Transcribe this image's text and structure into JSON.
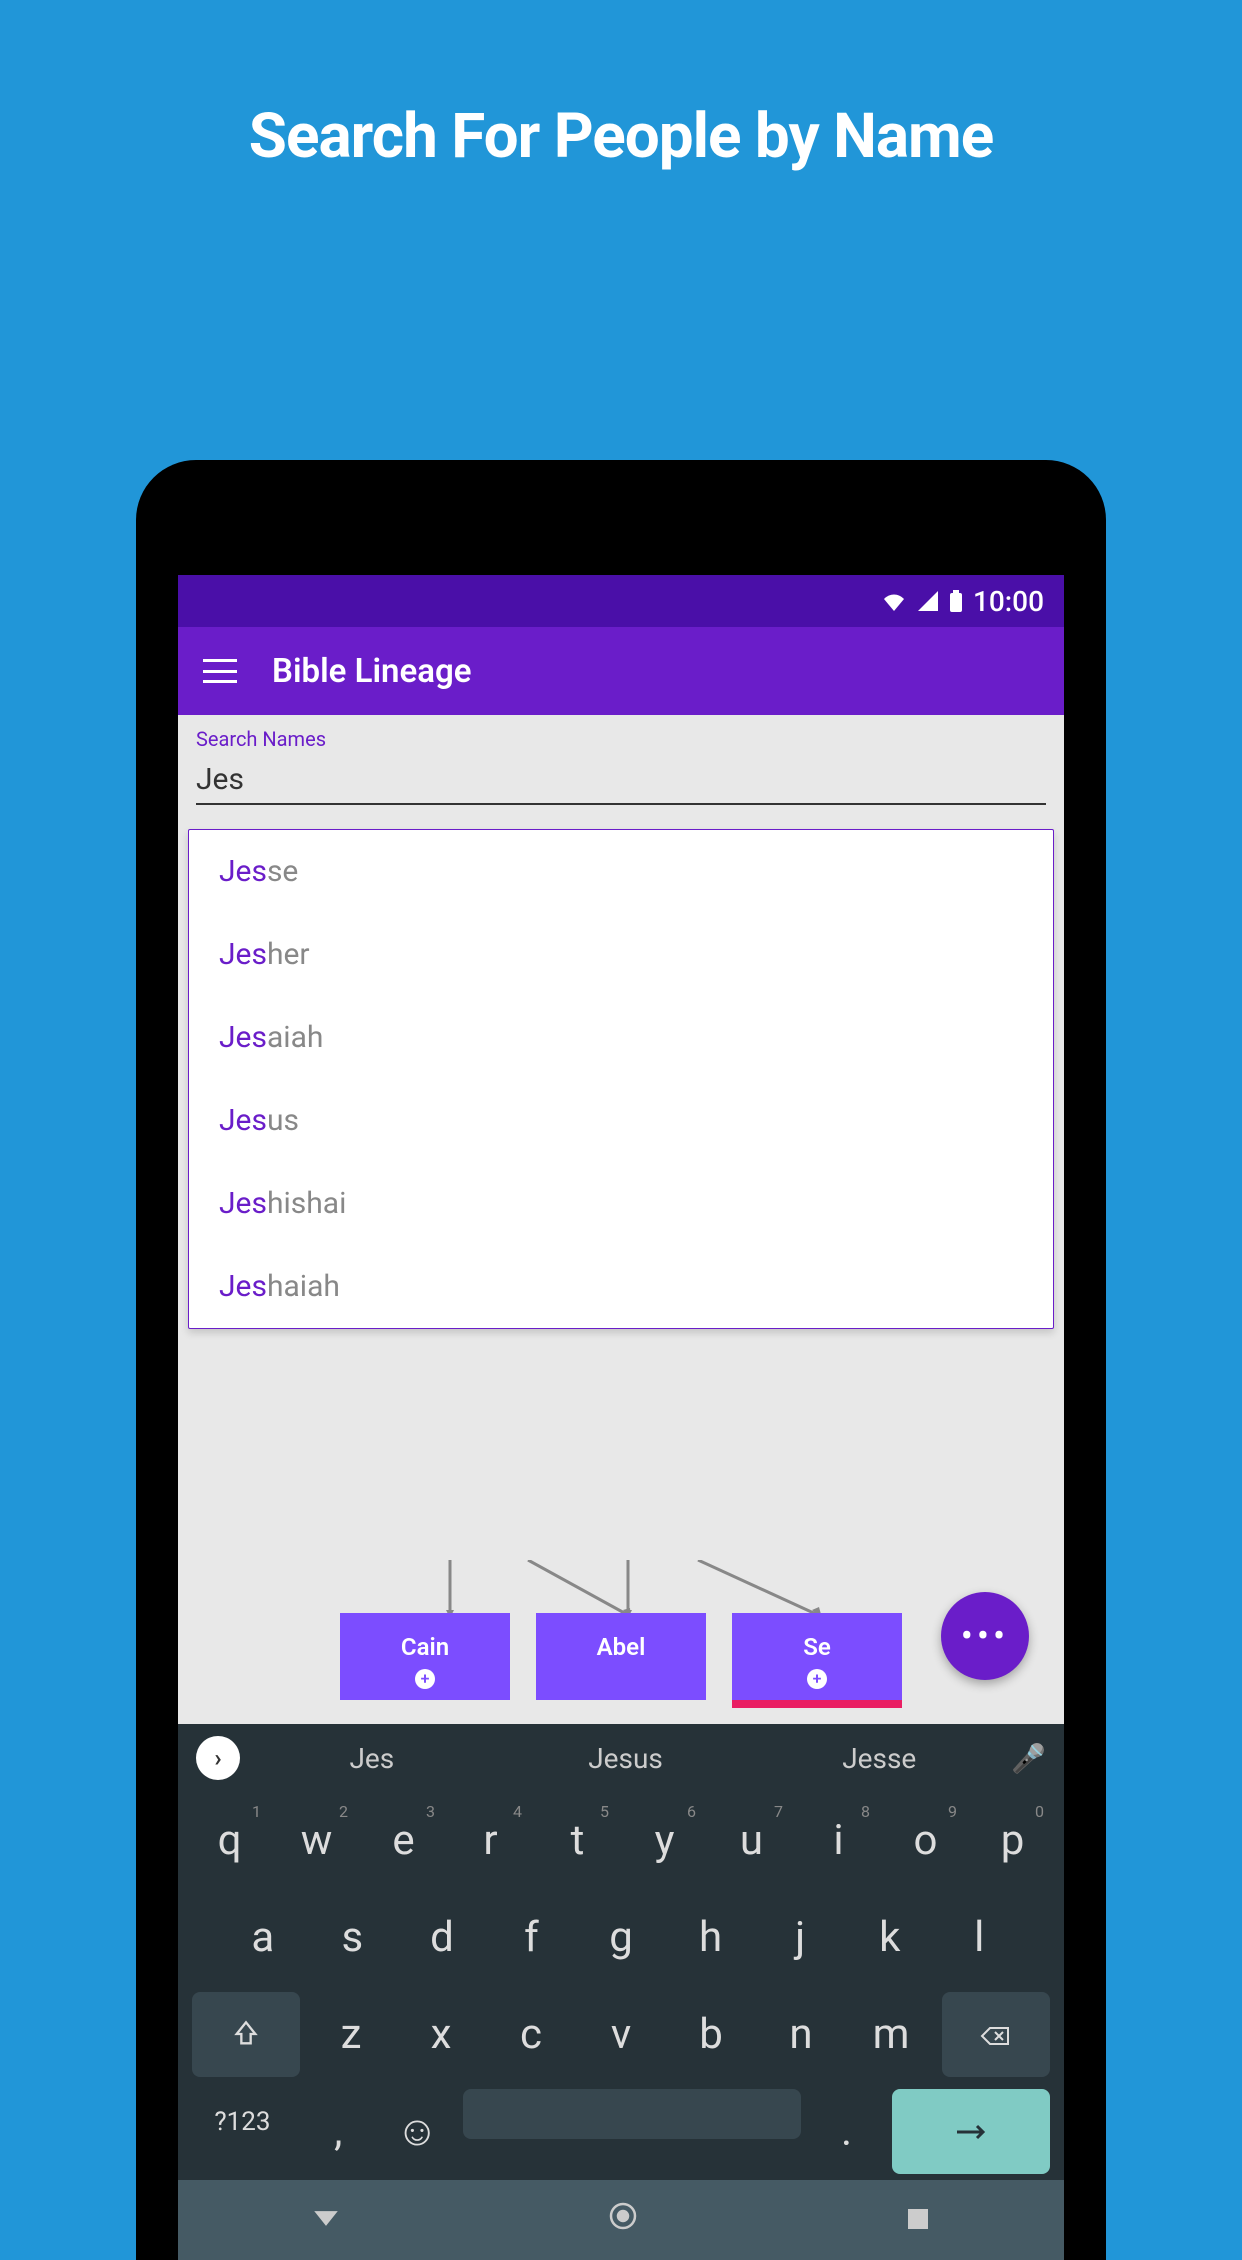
{
  "promo": {
    "title": "Search For People by Name"
  },
  "statusbar": {
    "time": "10:00"
  },
  "appbar": {
    "title": "Bible Lineage"
  },
  "search": {
    "label": "Search Names",
    "value": "Jes"
  },
  "suggestions": [
    {
      "prefix": "Jes",
      "suffix": "se"
    },
    {
      "prefix": "Jes",
      "suffix": "her"
    },
    {
      "prefix": "Jes",
      "suffix": "aiah"
    },
    {
      "prefix": "Jes",
      "suffix": "us"
    },
    {
      "prefix": "Jes",
      "suffix": "hishai"
    },
    {
      "prefix": "Jes",
      "suffix": "haiah"
    }
  ],
  "lineage": {
    "nodes": [
      {
        "name": "Cain"
      },
      {
        "name": "Abel"
      },
      {
        "name": "Se"
      }
    ]
  },
  "keyboard": {
    "suggestions": [
      "Jes",
      "Jesus",
      "Jesse"
    ],
    "row1": [
      {
        "key": "q",
        "num": "1"
      },
      {
        "key": "w",
        "num": "2"
      },
      {
        "key": "e",
        "num": "3"
      },
      {
        "key": "r",
        "num": "4"
      },
      {
        "key": "t",
        "num": "5"
      },
      {
        "key": "y",
        "num": "6"
      },
      {
        "key": "u",
        "num": "7"
      },
      {
        "key": "i",
        "num": "8"
      },
      {
        "key": "o",
        "num": "9"
      },
      {
        "key": "p",
        "num": "0"
      }
    ],
    "row2": [
      "a",
      "s",
      "d",
      "f",
      "g",
      "h",
      "j",
      "k",
      "l"
    ],
    "row3": [
      "z",
      "x",
      "c",
      "v",
      "b",
      "n",
      "m"
    ],
    "symbols_key": "?123",
    "comma_key": ",",
    "period_key": "."
  }
}
